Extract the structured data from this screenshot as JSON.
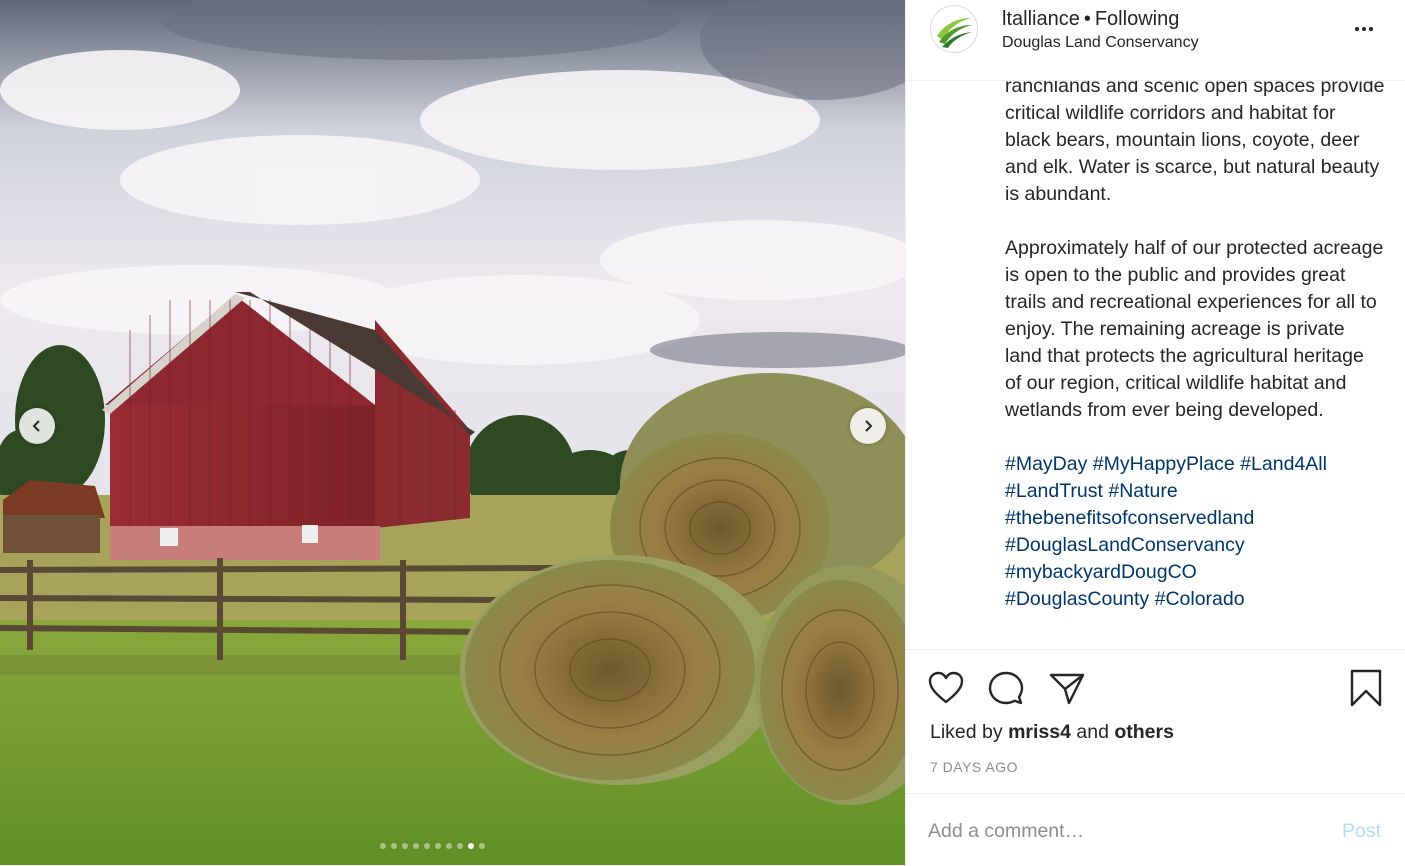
{
  "post": {
    "username": "ltalliance",
    "separator": "•",
    "follow_status": "Following",
    "location": "Douglas Land Conservancy",
    "more_options": "more-options-icon"
  },
  "caption": {
    "paragraph_1": "ranchlands and scenic open spaces provide critical wildlife corridors and habitat for black bears, mountain lions, coyote, deer and elk. Water is scarce, but natural beauty is abundant.",
    "paragraph_2": "Approximately half of our protected acreage is open to the public and provides great trails and recreational experiences for all to enjoy. The remaining acreage is private land that protects the agricultural heritage of our region, critical wildlife habitat and wetlands from ever being developed.",
    "hashtags": [
      "#MayDay",
      "#MyHappyPlace",
      "#Land4All",
      "#LandTrust",
      "#Nature",
      "#thebenefitsofconservedland",
      "#DouglasLandConservancy",
      "#mybackyardDougCO",
      "#DouglasCounty",
      "#Colorado"
    ]
  },
  "actions": {
    "icons": [
      "heart-icon",
      "comment-icon",
      "share-icon",
      "bookmark-icon"
    ]
  },
  "likes": {
    "prefix": "Liked by",
    "user": "mriss4",
    "conjunction": "and",
    "others": "others"
  },
  "timestamp": "7 DAYS AGO",
  "comment": {
    "placeholder": "Add a comment…",
    "post_label": "Post"
  },
  "carousel": {
    "slide_count": 10,
    "active_index": 8
  },
  "colors": {
    "barn_red": "#8b2a2e",
    "link_blue": "#00376b",
    "post_disabled": "#b2dffc",
    "grass_green": "#6f9a33"
  }
}
